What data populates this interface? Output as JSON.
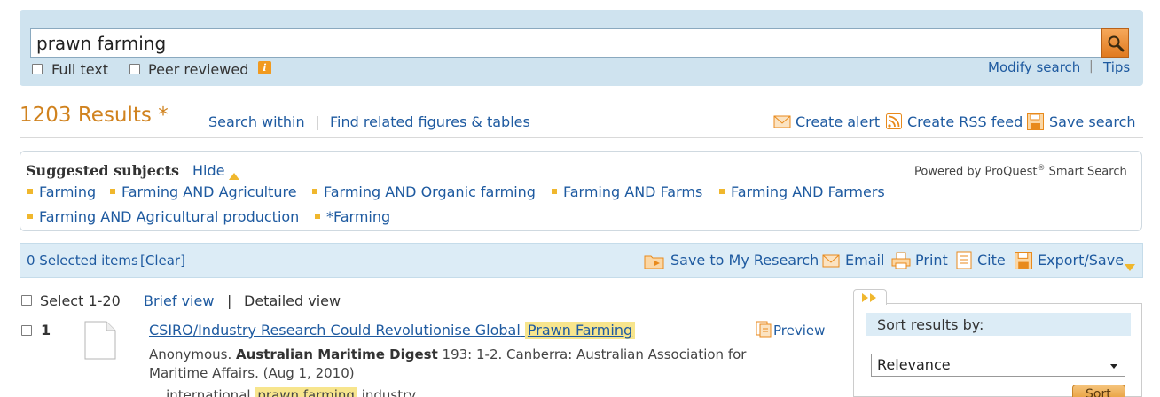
{
  "search": {
    "query": "prawn farming",
    "full_text_label": "Full text",
    "peer_reviewed_label": "Peer reviewed",
    "modify_search": "Modify search",
    "tips": "Tips"
  },
  "results": {
    "count_label": "1203 Results *",
    "search_within": "Search within",
    "find_related": "Find related figures & tables",
    "create_alert": "Create alert",
    "create_rss": "Create RSS feed",
    "save_search": "Save search"
  },
  "subjects": {
    "title": "Suggested subjects",
    "hide": "Hide",
    "powered_by": "Powered by ProQuest",
    "powered_reg": "®",
    "smart_search": "Smart Search",
    "items": [
      "Farming",
      "Farming AND Agriculture",
      "Farming AND Organic farming",
      "Farming AND Farms",
      "Farming AND Farmers",
      "Farming AND Agricultural production",
      "*Farming"
    ]
  },
  "selection": {
    "count": "0 Selected items",
    "clear": "[Clear]",
    "save_to_research": "Save to My Research",
    "email": "Email",
    "print": "Print",
    "cite": "Cite",
    "export": "Export/Save"
  },
  "list": {
    "select_range": "Select 1-20",
    "brief_view": "Brief view",
    "detailed_view": "Detailed view"
  },
  "result1": {
    "number": "1",
    "title_prefix": "CSIRO/Industry Research Could Revolutionise Global",
    "title_highlight": "Prawn Farming",
    "preview": "Preview",
    "author": "Anonymous.",
    "journal": "Australian Maritime Digest",
    "citation": "193: 1-2. Canberra: Australian Association for",
    "citation_line2": "Maritime Affairs. (Aug 1, 2010)",
    "snippet_prefix": "... international",
    "snippet_highlight": "prawn farming",
    "snippet_suffix": "industry..."
  },
  "sort": {
    "title": "Sort results by:",
    "selected": "Relevance",
    "button": "Sort"
  },
  "colors": {
    "accent_orange": "#d0821e",
    "link_blue": "#1e5aa0",
    "panel_blue": "#cfe3ef",
    "highlight": "#f7e58d"
  }
}
